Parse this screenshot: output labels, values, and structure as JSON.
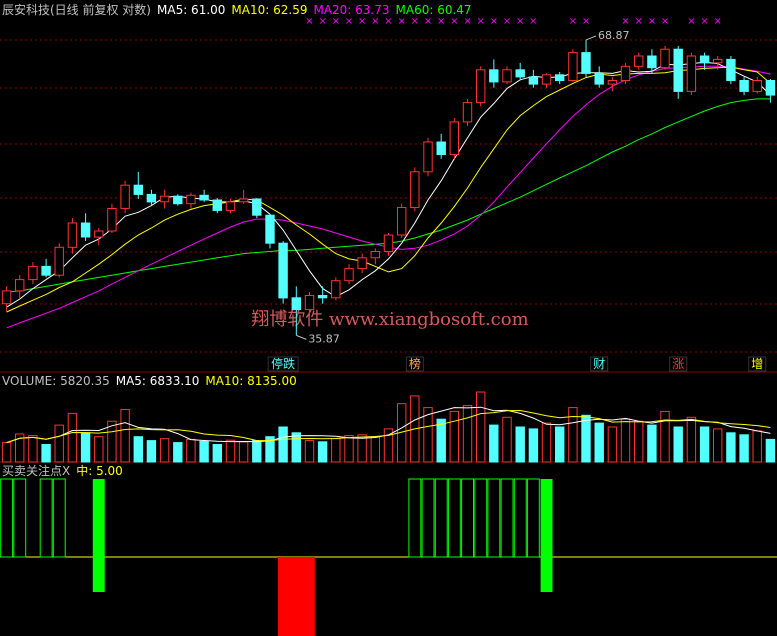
{
  "colors": {
    "bg": "#000000",
    "up": "#ff3232",
    "down": "#54ffff",
    "grid": "#8b0000",
    "ma5": "#ffffff",
    "ma10": "#ffff00",
    "ma20": "#ff00ff",
    "ma60": "#00ff00",
    "signal_green": "#00ff00",
    "signal_red": "#ff0000",
    "center_line": "#ffff00",
    "watermark": "#d35b5b",
    "label": "#c0c0c0"
  },
  "main_panel": {
    "title": "辰安科技(日线 前复权 对数)",
    "ma5_label": "MA5: 61.00",
    "ma10_label": "MA10: 62.59",
    "ma20_label": "MA20: 63.73",
    "ma60_label": "MA60: 60.47",
    "high_marker": "68.87",
    "low_marker": "35.87",
    "watermark": "翔博软件 www.xiangbosoft.com",
    "event_tags": [
      {
        "text": "停跌",
        "day": 21,
        "color": "#54ffff"
      },
      {
        "text": "榜",
        "day": 31,
        "color": "#ffaa55"
      },
      {
        "text": "财",
        "day": 45,
        "color": "#54ffff"
      },
      {
        "text": "涨",
        "day": 51,
        "color": "#ff3232"
      },
      {
        "text": "增",
        "day": 57,
        "color": "#ffff00"
      }
    ],
    "top_marker_glyph": "×",
    "top_marker_days": [
      23,
      24,
      25,
      26,
      27,
      28,
      29,
      30,
      31,
      32,
      33,
      34,
      35,
      36,
      37,
      38,
      39,
      40,
      43,
      44,
      47,
      48,
      49,
      50,
      52,
      53,
      54
    ]
  },
  "volume_panel": {
    "title": "VOLUME: 5820.35",
    "ma5_label": "MA5: 6833.10",
    "ma10_label": "MA10: 8135.00"
  },
  "indicator_panel": {
    "title": "买卖关注点X",
    "mid_label": "中: 5.00"
  },
  "chart_data": {
    "type": "candlestick",
    "scale": "log",
    "ylim": [
      34,
      72
    ],
    "candles": [
      [
        38.5,
        40.0,
        37.8,
        39.6
      ],
      [
        39.6,
        41.0,
        39.0,
        40.6
      ],
      [
        40.6,
        42.2,
        40.2,
        41.8
      ],
      [
        41.8,
        42.5,
        40.8,
        41.0
      ],
      [
        41.0,
        44.0,
        40.8,
        43.6
      ],
      [
        43.6,
        46.5,
        43.0,
        46.0
      ],
      [
        46.0,
        47.0,
        44.2,
        44.6
      ],
      [
        44.6,
        45.5,
        43.8,
        45.2
      ],
      [
        45.2,
        48.0,
        45.0,
        47.5
      ],
      [
        47.5,
        50.5,
        47.0,
        50.0
      ],
      [
        50.0,
        51.5,
        48.5,
        49.0
      ],
      [
        49.0,
        49.5,
        47.8,
        48.2
      ],
      [
        48.2,
        49.5,
        47.5,
        48.8
      ],
      [
        48.8,
        49.0,
        47.8,
        48.0
      ],
      [
        48.0,
        49.2,
        47.5,
        48.9
      ],
      [
        48.9,
        49.5,
        48.2,
        48.4
      ],
      [
        48.4,
        48.6,
        47.0,
        47.3
      ],
      [
        47.3,
        48.5,
        47.0,
        48.2
      ],
      [
        48.2,
        49.5,
        48.0,
        48.5
      ],
      [
        48.5,
        48.6,
        46.5,
        46.8
      ],
      [
        46.8,
        46.9,
        43.5,
        44.0
      ],
      [
        44.0,
        44.2,
        38.5,
        39.0
      ],
      [
        39.0,
        40.0,
        35.9,
        38.0
      ],
      [
        38.0,
        39.5,
        37.5,
        39.2
      ],
      [
        39.2,
        40.0,
        38.5,
        39.0
      ],
      [
        39.0,
        40.8,
        38.8,
        40.5
      ],
      [
        40.5,
        42.0,
        40.2,
        41.6
      ],
      [
        41.6,
        43.0,
        41.2,
        42.6
      ],
      [
        42.6,
        43.5,
        42.0,
        43.2
      ],
      [
        43.2,
        45.0,
        42.8,
        44.8
      ],
      [
        44.8,
        48.0,
        44.5,
        47.6
      ],
      [
        47.6,
        52.0,
        47.2,
        51.5
      ],
      [
        51.5,
        55.5,
        51.0,
        55.0
      ],
      [
        55.0,
        56.0,
        53.0,
        53.5
      ],
      [
        53.5,
        58.0,
        53.0,
        57.5
      ],
      [
        57.5,
        60.5,
        57.0,
        60.0
      ],
      [
        60.0,
        65.0,
        59.5,
        64.5
      ],
      [
        64.5,
        66.0,
        62.0,
        62.8
      ],
      [
        62.8,
        65.0,
        62.5,
        64.5
      ],
      [
        64.5,
        65.5,
        63.0,
        63.5
      ],
      [
        63.5,
        64.5,
        62.0,
        62.5
      ],
      [
        62.5,
        64.0,
        62.0,
        63.8
      ],
      [
        63.8,
        64.2,
        62.5,
        63.0
      ],
      [
        63.0,
        67.5,
        62.8,
        67.0
      ],
      [
        67.0,
        68.9,
        63.5,
        64.0
      ],
      [
        64.0,
        65.0,
        62.0,
        62.5
      ],
      [
        62.5,
        63.5,
        61.5,
        63.0
      ],
      [
        63.0,
        65.5,
        62.5,
        65.0
      ],
      [
        65.0,
        67.0,
        64.5,
        66.5
      ],
      [
        66.5,
        67.5,
        64.0,
        64.8
      ],
      [
        64.8,
        68.0,
        64.5,
        67.5
      ],
      [
        67.5,
        68.0,
        60.5,
        61.5
      ],
      [
        61.5,
        67.0,
        61.0,
        66.5
      ],
      [
        66.5,
        67.0,
        64.5,
        65.5
      ],
      [
        65.5,
        66.5,
        64.5,
        66.0
      ],
      [
        66.0,
        66.5,
        62.5,
        63.0
      ],
      [
        63.0,
        63.5,
        61.0,
        61.5
      ],
      [
        61.5,
        63.5,
        61.2,
        63.0
      ],
      [
        63.0,
        63.2,
        60.0,
        61.0
      ]
    ],
    "ma5": [
      38.2,
      38.9,
      39.8,
      40.6,
      41.4,
      42.6,
      43.8,
      44.4,
      45.4,
      46.7,
      47.1,
      47.8,
      48.7,
      48.8,
      48.6,
      48.5,
      48.2,
      48.2,
      48.3,
      48.0,
      46.9,
      45.3,
      43.3,
      41.4,
      39.8,
      39.1,
      39.7,
      40.6,
      41.4,
      42.5,
      44.0,
      46.0,
      48.4,
      50.5,
      53.0,
      55.5,
      58.1,
      59.9,
      61.9,
      63.1,
      63.6,
      63.4,
      63.5,
      64.0,
      64.1,
      64.1,
      64.0,
      64.4,
      64.2,
      64.3,
      65.3,
      65.2,
      65.4,
      65.6,
      65.4,
      64.5,
      63.6,
      62.8,
      61.0
    ],
    "ma10": [
      37.8,
      38.3,
      38.8,
      39.3,
      39.9,
      40.4,
      41.2,
      42.0,
      42.9,
      43.9,
      44.8,
      45.5,
      46.3,
      46.9,
      47.4,
      47.8,
      48.0,
      48.2,
      48.5,
      48.4,
      47.6,
      46.8,
      45.8,
      44.9,
      43.9,
      43.0,
      42.5,
      42.3,
      41.8,
      41.3,
      41.6,
      42.8,
      44.5,
      46.0,
      47.7,
      49.7,
      52.0,
      54.2,
      56.5,
      58.3,
      59.6,
      60.8,
      61.7,
      62.6,
      63.4,
      63.9,
      63.7,
      63.9,
      64.0,
      64.0,
      64.1,
      64.4,
      64.5,
      64.7,
      64.8,
      64.9,
      64.5,
      64.2,
      62.6
    ],
    "ma20": [
      36.5,
      36.9,
      37.3,
      37.7,
      38.1,
      38.6,
      39.1,
      39.6,
      40.2,
      40.8,
      41.4,
      42.0,
      42.6,
      43.2,
      43.8,
      44.4,
      45.0,
      45.6,
      46.1,
      46.4,
      46.4,
      46.3,
      46.0,
      45.7,
      45.4,
      45.0,
      44.6,
      44.2,
      43.9,
      43.6,
      43.4,
      43.5,
      43.8,
      44.3,
      44.9,
      45.7,
      46.8,
      48.2,
      49.8,
      51.4,
      53.1,
      54.8,
      56.5,
      58.2,
      59.7,
      61.1,
      62.2,
      63.1,
      63.8,
      64.3,
      64.7,
      64.8,
      64.9,
      65.0,
      65.0,
      64.9,
      64.6,
      64.3,
      63.9
    ],
    "ma60": [
      39.5,
      39.6,
      39.8,
      40.0,
      40.2,
      40.4,
      40.6,
      40.8,
      41.0,
      41.2,
      41.4,
      41.6,
      41.8,
      42.0,
      42.2,
      42.4,
      42.6,
      42.8,
      43.0,
      43.1,
      43.2,
      43.3,
      43.3,
      43.4,
      43.5,
      43.6,
      43.7,
      43.8,
      43.9,
      44.0,
      44.2,
      44.5,
      44.9,
      45.3,
      45.8,
      46.3,
      46.9,
      47.5,
      48.1,
      48.7,
      49.4,
      50.1,
      50.8,
      51.5,
      52.2,
      53.0,
      53.8,
      54.5,
      55.3,
      56.0,
      56.8,
      57.5,
      58.2,
      58.9,
      59.5,
      60.0,
      60.3,
      60.5,
      60.5
    ],
    "volume": [
      5000,
      7200,
      6800,
      4500,
      9500,
      12500,
      7500,
      6500,
      10500,
      13500,
      6500,
      5500,
      6000,
      5000,
      5800,
      5300,
      4500,
      5600,
      5200,
      5500,
      6500,
      9000,
      7500,
      5500,
      5200,
      6000,
      6800,
      7000,
      6500,
      8500,
      15000,
      17000,
      14000,
      11000,
      13000,
      14500,
      18000,
      9500,
      11500,
      9000,
      8500,
      10000,
      9000,
      14000,
      12000,
      10000,
      9000,
      11000,
      10500,
      9500,
      13000,
      9000,
      11500,
      9000,
      8500,
      7500,
      7000,
      8000,
      5800
    ],
    "signal": [
      4,
      4,
      0,
      4,
      4,
      0,
      0,
      -2,
      0,
      0,
      0,
      0,
      0,
      0,
      0,
      0,
      0,
      0,
      0,
      0,
      0,
      0,
      -3,
      0,
      0,
      0,
      0,
      0,
      0,
      0,
      0,
      4,
      4,
      4,
      4,
      4,
      4,
      4,
      4,
      4,
      4,
      -2,
      0,
      0,
      0,
      0,
      0,
      0,
      0,
      0,
      0,
      0,
      0,
      0,
      0,
      0,
      0,
      0,
      0
    ]
  }
}
